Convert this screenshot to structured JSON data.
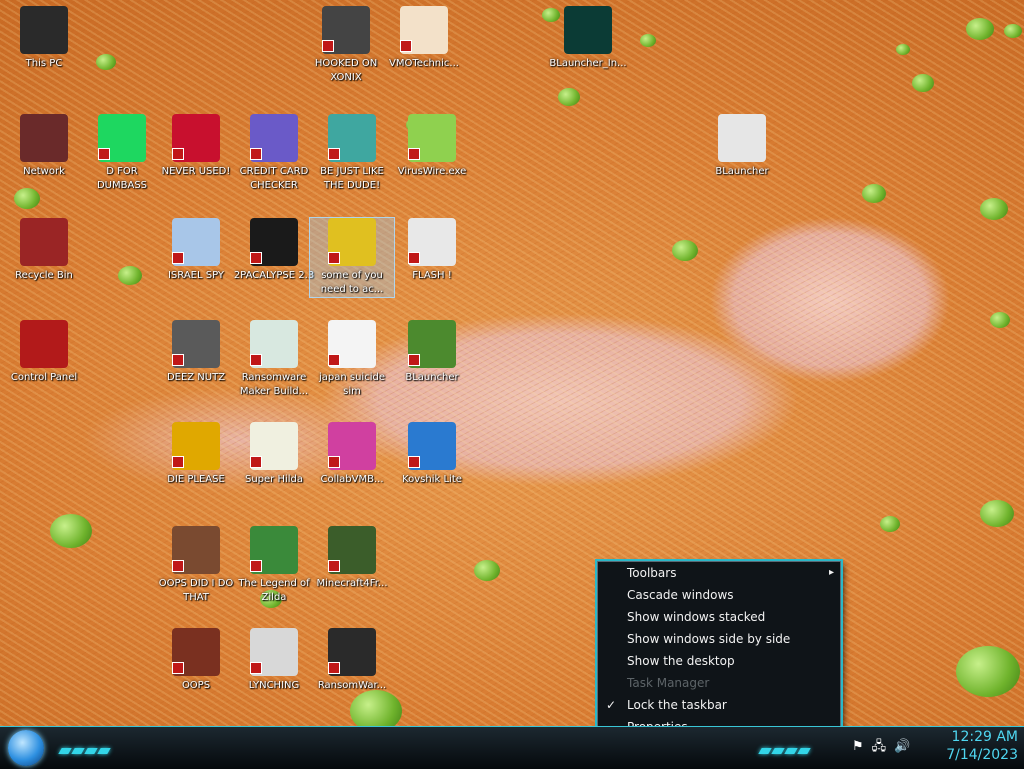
{
  "desktop": {
    "icons": [
      {
        "label": "This PC",
        "icon": "computer-icon",
        "bg": "#2a2a2a"
      },
      {
        "label": "HOOKED ON XONIX",
        "icon": "game-icon",
        "bg": "#444444"
      },
      {
        "label": "VMOTechnic...",
        "icon": "doctor-icon",
        "bg": "#f3e1c9"
      },
      {
        "label": "BLauncher_In...",
        "icon": "bl-logo-icon",
        "bg": "#0b3b35"
      },
      {
        "label": "Network",
        "icon": "network-icon",
        "bg": "#6a2a2a"
      },
      {
        "label": "D FOR DUMBASS",
        "icon": "chat-icon",
        "bg": "#1ed760"
      },
      {
        "label": "NEVER USED!",
        "icon": "devcpp-icon",
        "bg": "#c8102e"
      },
      {
        "label": "CREDIT CARD CHECKER",
        "icon": "credit-card-icon",
        "bg": "#6a5ac8"
      },
      {
        "label": "BE JUST LIKE THE DUDE!",
        "icon": "santa-icon",
        "bg": "#3fa7a0"
      },
      {
        "label": "VirusWire.exe",
        "icon": "lime-icon",
        "bg": "#8fd14f"
      },
      {
        "label": "BLauncher",
        "icon": "blauncher-icon",
        "bg": "#e6e6e6"
      },
      {
        "label": "Recycle Bin",
        "icon": "recycle-bin-icon",
        "bg": "#9a2525"
      },
      {
        "label": "ISRAEL SPY",
        "icon": "network-computers-icon",
        "bg": "#a8c6e8"
      },
      {
        "label": "2PACALYPSE 2.3",
        "icon": "terminal-icon",
        "bg": "#1a1a1a"
      },
      {
        "label": "some of you need to ac...",
        "icon": "beaver-icon",
        "bg": "#e0c020"
      },
      {
        "label": "FLASH !",
        "icon": "flash-icon",
        "bg": "#e8e8e8"
      },
      {
        "label": "Control Panel",
        "icon": "control-panel-icon",
        "bg": "#b21a1a"
      },
      {
        "label": "DEEZ NUTZ",
        "icon": "windows-stack-icon",
        "bg": "#5a5a5a"
      },
      {
        "label": "Ransomware Maker Build...",
        "icon": "window-app-icon",
        "bg": "#d8e8e0"
      },
      {
        "label": "japan suicide sim",
        "icon": "japan-sim-icon",
        "bg": "#f4f4f4"
      },
      {
        "label": "BLauncher",
        "icon": "grass-block-icon",
        "bg": "#4c8a2e"
      },
      {
        "label": "DIE PLEASE",
        "icon": "de-app-icon",
        "bg": "#e0a800"
      },
      {
        "label": "Super Hilda",
        "icon": "pixel-character-icon",
        "bg": "#f0f0e0"
      },
      {
        "label": "CollabVMB...",
        "icon": "monitor-icon",
        "bg": "#d040a0"
      },
      {
        "label": "Kovshik Lite",
        "icon": "ladle-icon",
        "bg": "#2a7ad0"
      },
      {
        "label": "OOPS DID I DO THAT",
        "icon": "portrait-icon",
        "bg": "#7a4a30"
      },
      {
        "label": "The Legend of Zilda",
        "icon": "zelda-character-icon",
        "bg": "#3a8a3a"
      },
      {
        "label": "Minecraft4Fr...",
        "icon": "minecraft-block-icon",
        "bg": "#3b5d2a"
      },
      {
        "label": "OOPS",
        "icon": "box-icon",
        "bg": "#7a3020"
      },
      {
        "label": "LYNCHING",
        "icon": "noose-icon",
        "bg": "#d8d8d8"
      },
      {
        "label": "RansomWar...",
        "icon": "skull-icon",
        "bg": "#2a2a2a"
      }
    ]
  },
  "context_menu": {
    "items": [
      {
        "label": "Toolbars",
        "has_submenu": true,
        "disabled": false,
        "checked": false
      },
      {
        "label": "Cascade windows",
        "has_submenu": false,
        "disabled": false,
        "checked": false
      },
      {
        "label": "Show windows stacked",
        "has_submenu": false,
        "disabled": false,
        "checked": false
      },
      {
        "label": "Show windows side by side",
        "has_submenu": false,
        "disabled": false,
        "checked": false
      },
      {
        "label": "Show the desktop",
        "has_submenu": false,
        "disabled": false,
        "checked": false
      },
      {
        "label": "Task Manager",
        "has_submenu": false,
        "disabled": true,
        "checked": false
      },
      {
        "label": "Lock the taskbar",
        "has_submenu": false,
        "disabled": false,
        "checked": true
      },
      {
        "label": "Properties",
        "has_submenu": false,
        "disabled": false,
        "checked": false
      }
    ],
    "submenu_glyph": "▸",
    "check_glyph": "✓"
  },
  "taskbar": {
    "tray_icons": [
      {
        "icon": "flag-icon",
        "glyph": "⚑"
      },
      {
        "icon": "network-tray-icon",
        "glyph": "🖧"
      },
      {
        "icon": "volume-icon",
        "glyph": "🔊"
      }
    ],
    "clock": {
      "time": "12:29 AM",
      "date": "7/14/2023"
    }
  },
  "colors": {
    "accent": "#33d5e8",
    "clock": "#4fd6f0",
    "menu_bg": "#0f1418"
  }
}
